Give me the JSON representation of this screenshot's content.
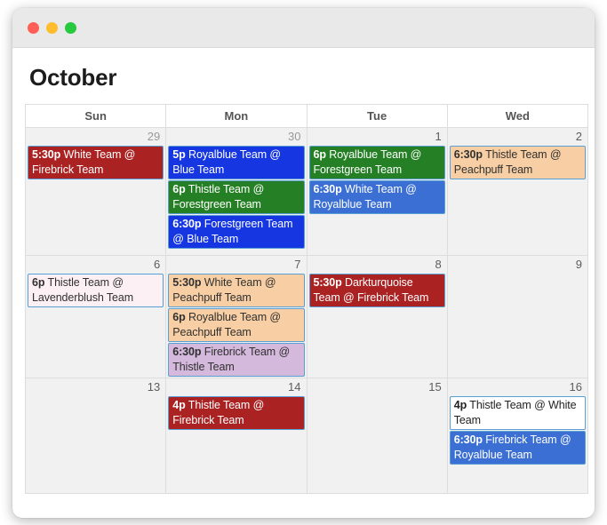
{
  "window": {
    "traffic_lights": [
      {
        "name": "close-button",
        "color": "#ff5f56"
      },
      {
        "name": "minimize-button",
        "color": "#ffbd2e"
      },
      {
        "name": "maximize-button",
        "color": "#27c93f"
      }
    ]
  },
  "calendar": {
    "month_title": "October",
    "day_headers": [
      "Sun",
      "Mon",
      "Tue",
      "Wed"
    ],
    "weeks": [
      {
        "days": [
          {
            "daynum": "29",
            "in_month": false,
            "events": [
              {
                "time": "5:30p",
                "title": "White Team @ Firebrick Team",
                "theme": "ev-firebrick"
              }
            ]
          },
          {
            "daynum": "30",
            "in_month": false,
            "events": [
              {
                "time": "5p",
                "title": "Royalblue Team @ Blue Team",
                "theme": "ev-royalblue"
              },
              {
                "time": "6p",
                "title": "Thistle Team @ Forestgreen Team",
                "theme": "ev-forestgreen"
              },
              {
                "time": "6:30p",
                "title": "Forestgreen Team @ Blue Team",
                "theme": "ev-royalblue"
              }
            ]
          },
          {
            "daynum": "1",
            "in_month": true,
            "events": [
              {
                "time": "6p",
                "title": "Royalblue Team @ Forestgreen Team",
                "theme": "ev-forestgreen"
              },
              {
                "time": "6:30p",
                "title": "White Team @ Royalblue Team",
                "theme": "ev-blue"
              }
            ]
          },
          {
            "daynum": "2",
            "in_month": true,
            "events": [
              {
                "time": "6:30p",
                "title": "Thistle Team @ Peachpuff Team",
                "theme": "ev-peachpuff"
              }
            ]
          }
        ]
      },
      {
        "days": [
          {
            "daynum": "6",
            "in_month": true,
            "events": [
              {
                "time": "6p",
                "title": "Thistle Team @ Lavenderblush Team",
                "theme": "ev-lavenderblush"
              }
            ]
          },
          {
            "daynum": "7",
            "in_month": true,
            "events": [
              {
                "time": "5:30p",
                "title": "White Team @ Peachpuff Team",
                "theme": "ev-peachpuff"
              },
              {
                "time": "6p",
                "title": "Royalblue Team @ Peachpuff Team",
                "theme": "ev-peachpuff"
              },
              {
                "time": "6:30p",
                "title": "Firebrick Team @ Thistle Team",
                "theme": "ev-thistle"
              }
            ]
          },
          {
            "daynum": "8",
            "in_month": true,
            "events": [
              {
                "time": "5:30p",
                "title": "Darkturquoise Team @ Firebrick Team",
                "theme": "ev-firebrick"
              }
            ]
          },
          {
            "daynum": "9",
            "in_month": true,
            "events": []
          }
        ]
      },
      {
        "days": [
          {
            "daynum": "13",
            "in_month": true,
            "events": []
          },
          {
            "daynum": "14",
            "in_month": true,
            "events": [
              {
                "time": "4p",
                "title": "Thistle Team @ Firebrick Team",
                "theme": "ev-firebrick"
              }
            ]
          },
          {
            "daynum": "15",
            "in_month": true,
            "events": []
          },
          {
            "daynum": "16",
            "in_month": true,
            "events": [
              {
                "time": "4p",
                "title": "Thistle Team @ White Team",
                "theme": "ev-white"
              },
              {
                "time": "6:30p",
                "title": "Firebrick Team @ Royalblue Team",
                "theme": "ev-blue"
              }
            ]
          }
        ]
      }
    ]
  }
}
